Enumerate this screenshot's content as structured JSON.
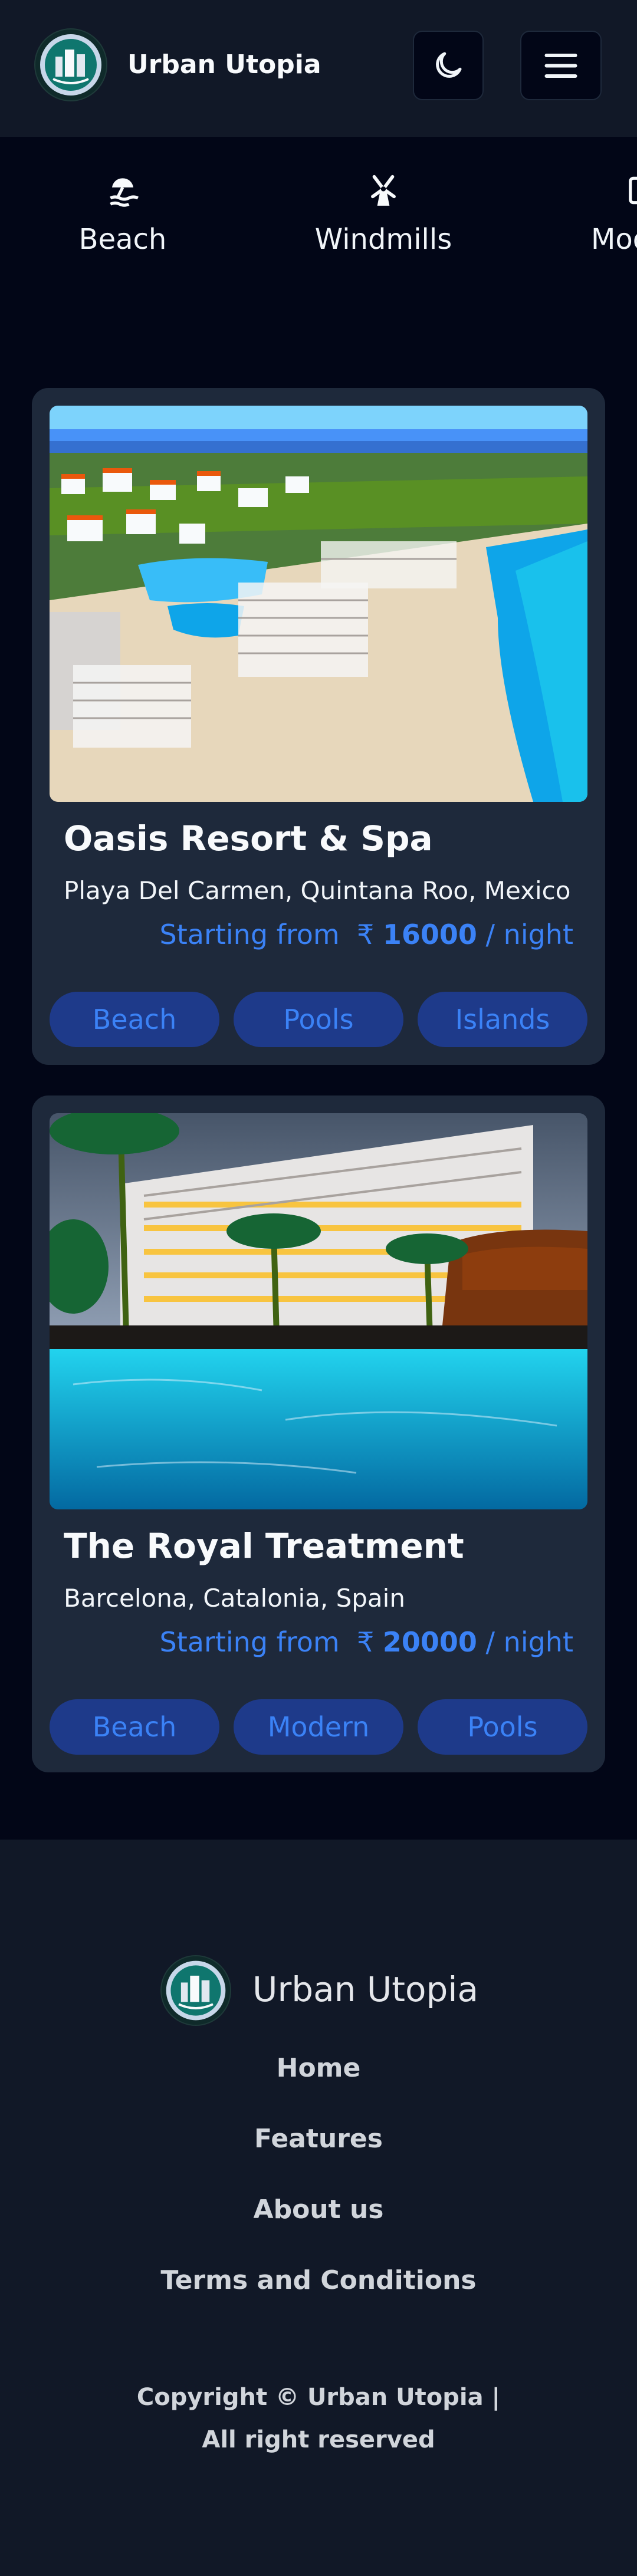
{
  "header": {
    "brand": "Urban Utopia",
    "logo_icon": "city-emblem-icon",
    "theme_toggle_icon": "moon-icon",
    "menu_icon": "hamburger-menu-icon"
  },
  "categories": [
    {
      "label": "Beach",
      "icon": "beach-icon"
    },
    {
      "label": "Windmills",
      "icon": "windmill-icon"
    },
    {
      "label": "Modern",
      "icon": "modern-icon"
    }
  ],
  "listings": [
    {
      "title": "Oasis Resort & Spa",
      "location": "Playa Del Carmen, Quintana Roo, Mexico",
      "price_prefix": "Starting from",
      "currency": "₹",
      "price": "16000",
      "price_suffix": "/ night",
      "tags": [
        "Beach",
        "Pools",
        "Islands"
      ]
    },
    {
      "title": "The Royal Treatment",
      "location": "Barcelona, Catalonia, Spain",
      "price_prefix": "Starting from",
      "currency": "₹",
      "price": "20000",
      "price_suffix": "/ night",
      "tags": [
        "Beach",
        "Modern",
        "Pools"
      ]
    }
  ],
  "footer": {
    "brand": "Urban Utopia",
    "links": [
      "Home",
      "Features",
      "About us",
      "Terms and Conditions"
    ],
    "copyright_line1": "Copyright © Urban Utopia |",
    "copyright_line2": "All right reserved"
  },
  "colors": {
    "page_bg": "#020617",
    "header_bg": "#111827",
    "card_bg": "#1e293b",
    "accent": "#3b82f6",
    "tag_bg": "#1e3a8a"
  }
}
